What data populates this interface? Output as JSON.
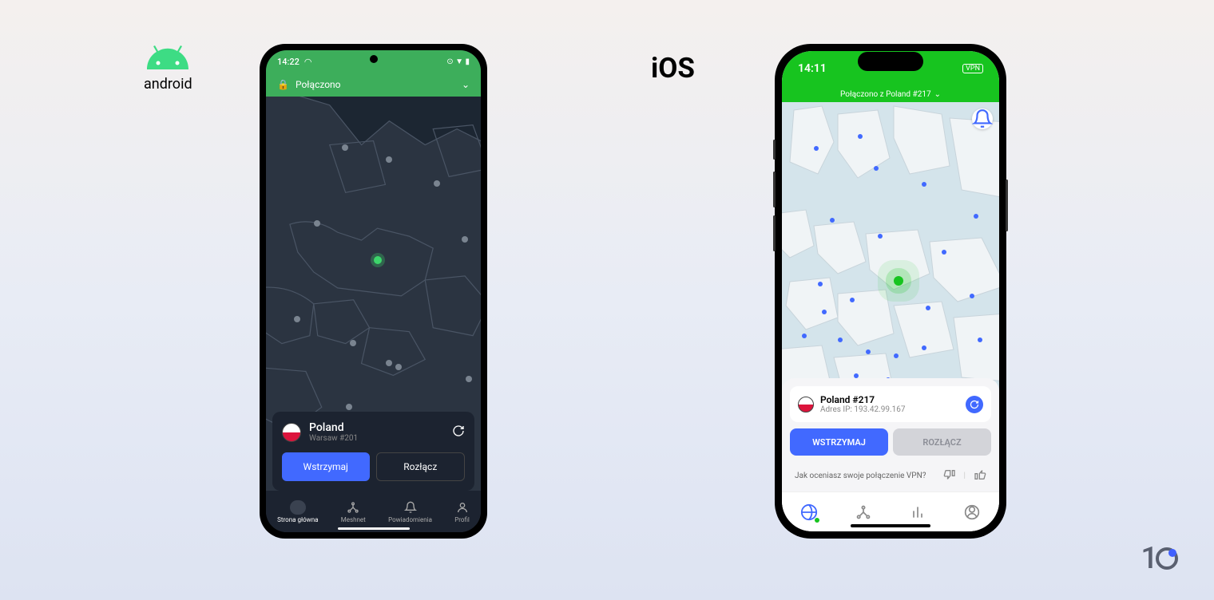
{
  "labels": {
    "android": "android",
    "ios": "iOS",
    "watermark": "1"
  },
  "android": {
    "status_time": "14:22",
    "connection_status": "Połączono",
    "server": {
      "country": "Poland",
      "name": "Warsaw #201"
    },
    "buttons": {
      "pause": "Wstrzymaj",
      "disconnect": "Rozłącz"
    },
    "nav": [
      {
        "icon": "globe",
        "label": "Strona główna",
        "active": true
      },
      {
        "icon": "mesh",
        "label": "Meshnet",
        "active": false
      },
      {
        "icon": "bell",
        "label": "Powiadomienia",
        "active": false
      },
      {
        "icon": "user",
        "label": "Profil",
        "active": false
      }
    ]
  },
  "ios": {
    "status_time": "14:11",
    "vpn_badge": "VPN",
    "connection_status": "Połączono z Poland #217",
    "server": {
      "name": "Poland #217",
      "ip": "Adres IP: 193.42.99.167"
    },
    "buttons": {
      "pause": "WSTRZYMAJ",
      "disconnect": "ROZŁĄCZ"
    },
    "rating_question": "Jak oceniasz swoje połączenie VPN?"
  }
}
